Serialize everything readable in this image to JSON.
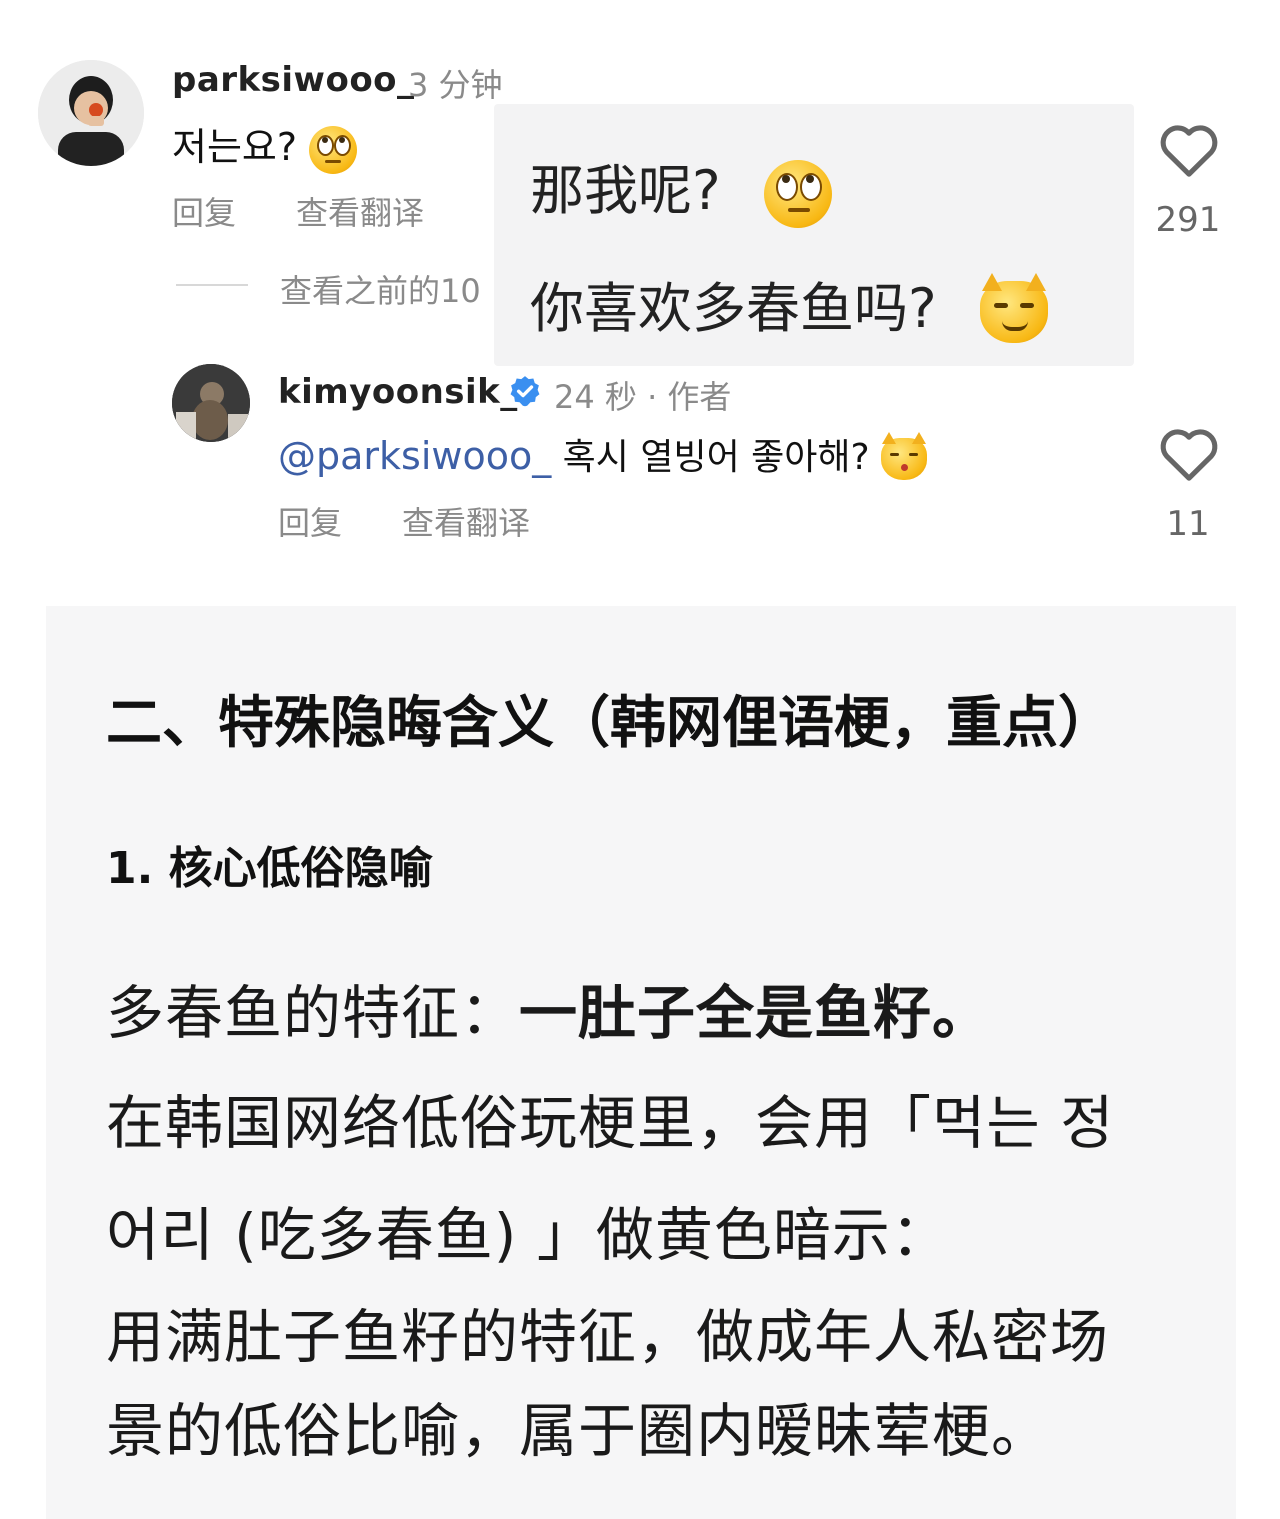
{
  "comment1": {
    "username": "parksiwooo_",
    "time": "3 分钟",
    "text": "저는요?",
    "reply_label": "回复",
    "translate_label": "查看翻译",
    "likes": "291"
  },
  "view_previous": "查看之前的10",
  "comment2": {
    "username": "kimyoonsik_",
    "meta": "24 秒 · 作者",
    "mention": "@parksiwooo_",
    "text": "혹시 열빙어 좋아해?",
    "reply_label": "回复",
    "translate_label": "查看翻译",
    "likes": "11"
  },
  "overlay": {
    "line1": "那我呢?",
    "line2": "你喜欢多春鱼吗?"
  },
  "card": {
    "heading": "二、特殊隐晦含义（韩网俚语梗，重点）",
    "subheading": "1. 核心低俗隐喻",
    "p1_prefix": "多春鱼的特征：",
    "p1_bold": "一肚子全是鱼籽。",
    "p2": "在韩国网络低俗玩梗里，会用「먹는 정",
    "p3": "어리 (吃多春鱼) 」做黄色暗示：",
    "p4": "用满肚子鱼籽的特征，做成年人私密场",
    "p5": "景的低俗比喻，属于圈内暧昧荤梗。"
  }
}
